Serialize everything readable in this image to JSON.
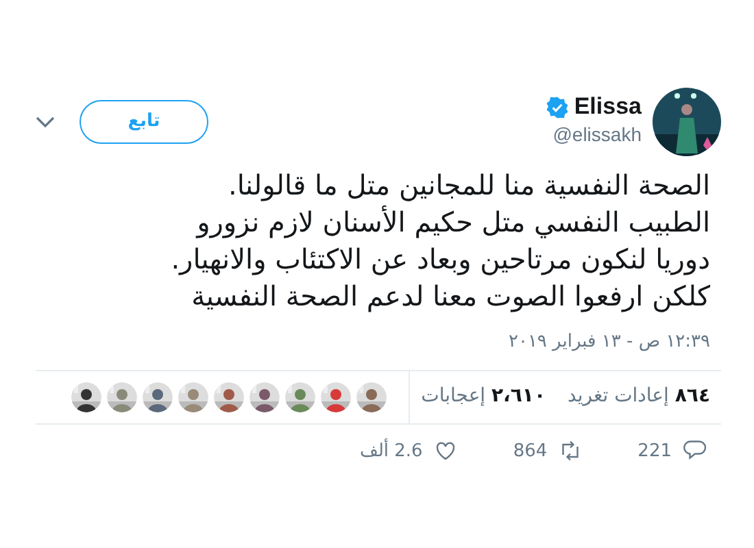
{
  "author": {
    "name": "Elissa",
    "handle": "@elissakh",
    "verified": true
  },
  "follow_button": "تابع",
  "tweet_text": "الصحة النفسية منا للمجانين متل ما قالولنا.\nالطبيب النفسي متل حكيم الأسنان لازم نزورو\nدوريا لنكون مرتاحين وبعاد عن الاكتئاب والانهيار.\nكلكن ارفعوا الصوت معنا لدعم الصحة النفسية",
  "timestamp": "١٢:٣٩ ص - ١٣ فبراير ٢٠١٩",
  "stats": [
    {
      "count": "٨٦٤",
      "label": "إعادات تغريد"
    },
    {
      "count": "٢،٦١٠",
      "label": "إعجابات"
    }
  ],
  "likers": [
    {
      "color": "#8a6a58"
    },
    {
      "color": "#d83a3a"
    },
    {
      "color": "#6a8a5a"
    },
    {
      "color": "#7a5a6a"
    },
    {
      "color": "#a05a4a"
    },
    {
      "color": "#9a8a7a"
    },
    {
      "color": "#5a6a7a"
    },
    {
      "color": "#8a8a7a"
    },
    {
      "color": "#333333"
    }
  ],
  "actions": [
    {
      "kind": "reply",
      "count": "221"
    },
    {
      "kind": "retweet",
      "count": "864"
    },
    {
      "kind": "like",
      "count": "2.6 ألف"
    }
  ]
}
